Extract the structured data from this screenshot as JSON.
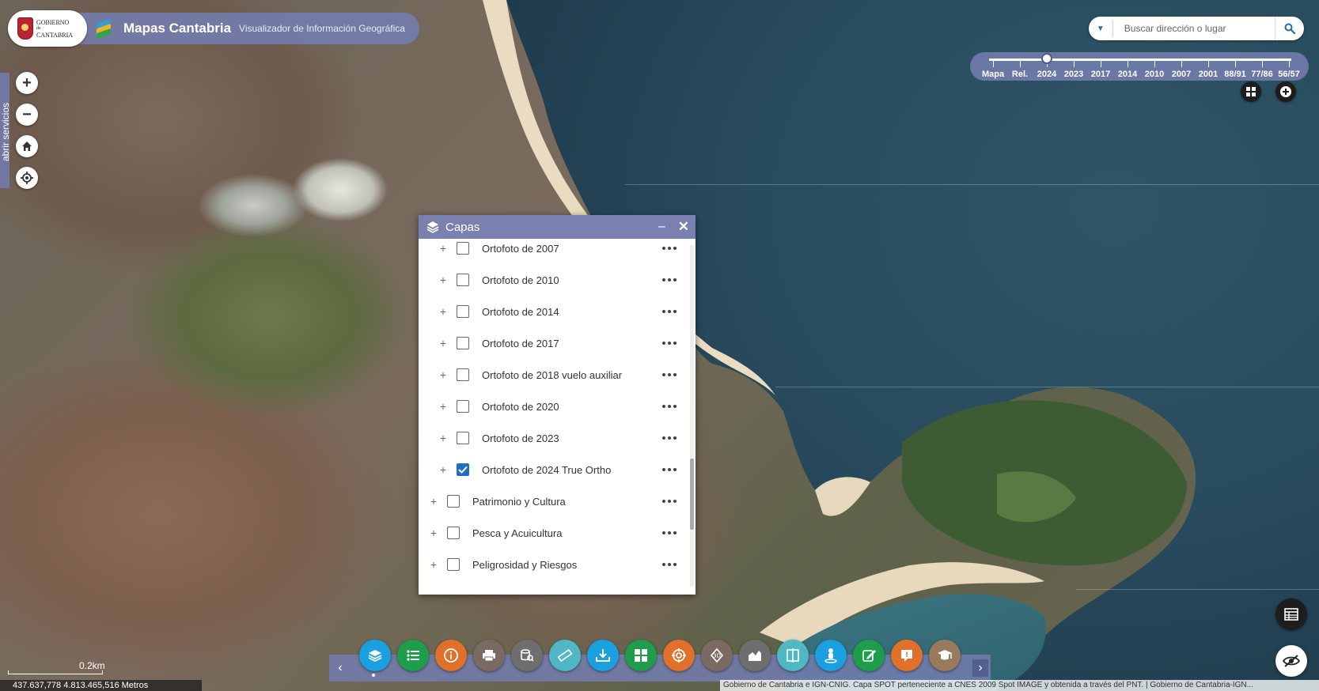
{
  "header": {
    "gov_line1": "GOBIERNO",
    "gov_line2": "de",
    "gov_line3": "CANTABRIA",
    "title": "Mapas Cantabria",
    "subtitle": "Visualizador de Información Geográfica"
  },
  "search": {
    "placeholder": "Buscar dirección o lugar",
    "icon": "search-icon"
  },
  "timeline": {
    "labels": [
      "Mapa",
      "Rel.",
      "2024",
      "2023",
      "2017",
      "2014",
      "2010",
      "2007",
      "2001",
      "88/91",
      "77/86",
      "56/57"
    ],
    "selected": "2024"
  },
  "side": {
    "services_label": "abrir servicios"
  },
  "panel": {
    "title": "Capas",
    "layers": [
      {
        "label": "Ortofoto de 2007",
        "checked": false,
        "sub": true
      },
      {
        "label": "Ortofoto de 2010",
        "checked": false,
        "sub": true
      },
      {
        "label": "Ortofoto de 2014",
        "checked": false,
        "sub": true
      },
      {
        "label": "Ortofoto de 2017",
        "checked": false,
        "sub": true
      },
      {
        "label": "Ortofoto de 2018 vuelo auxiliar",
        "checked": false,
        "sub": true
      },
      {
        "label": "Ortofoto de 2020",
        "checked": false,
        "sub": true
      },
      {
        "label": "Ortofoto de 2023",
        "checked": false,
        "sub": true
      },
      {
        "label": "Ortofoto de 2024 True Ortho",
        "checked": true,
        "sub": true
      },
      {
        "label": "Patrimonio y Cultura",
        "checked": false,
        "sub": false
      },
      {
        "label": "Pesca y Acuicultura",
        "checked": false,
        "sub": false
      },
      {
        "label": "Peligrosidad y Riesgos",
        "checked": false,
        "sub": false
      }
    ]
  },
  "toolbar": {
    "tools": [
      {
        "name": "layers-icon",
        "color": "#1aa0e0"
      },
      {
        "name": "legend-list-icon",
        "color": "#1e9d4a"
      },
      {
        "name": "info-icon",
        "color": "#e0702a"
      },
      {
        "name": "print-icon",
        "color": "#7a6a62"
      },
      {
        "name": "query-icon",
        "color": "#6e6e6e"
      },
      {
        "name": "measure-icon",
        "color": "#4fb8c4"
      },
      {
        "name": "download-icon",
        "color": "#1aa0e0"
      },
      {
        "name": "grid-icon",
        "color": "#1e9d4a"
      },
      {
        "name": "target-icon",
        "color": "#e0702a"
      },
      {
        "name": "3d-icon",
        "color": "#7a6a62"
      },
      {
        "name": "profile-chart-icon",
        "color": "#6e6e6e"
      },
      {
        "name": "swipe-compare-icon",
        "color": "#4fb8c4"
      },
      {
        "name": "streetview-person-icon",
        "color": "#1aa0e0"
      },
      {
        "name": "edit-icon",
        "color": "#1e9d4a"
      },
      {
        "name": "help-icon",
        "color": "#e0702a"
      },
      {
        "name": "education-icon",
        "color": "#9a7a5c"
      }
    ]
  },
  "status": {
    "scale_label": "0.2km",
    "coordinates": "437.637,778  4.813.465,516 Metros",
    "attribution": "Gobierno de Cantabria e IGN-CNIG. Capa SPOT perteneciente a CNES 2009 Spot IMAGE y obtenida a través del PNT. | Gobierno de Cantabria-IGN..."
  },
  "colors": {
    "panel_header": "#7a80b0",
    "sea": "#2c4f62",
    "accent": "#1f6fc0"
  }
}
